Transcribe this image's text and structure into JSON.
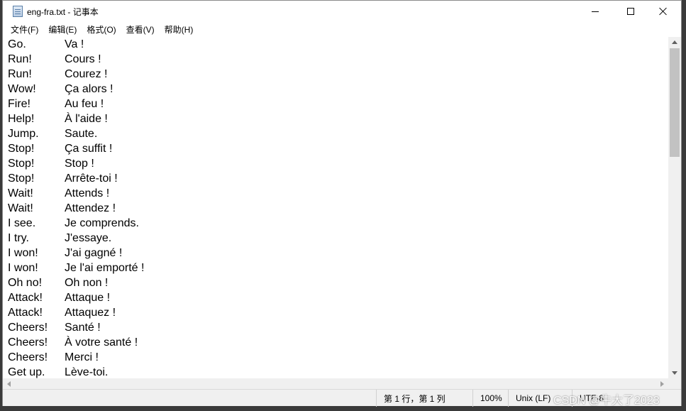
{
  "window": {
    "title": "eng-fra.txt - 记事本",
    "app_icon": "notepad-icon"
  },
  "menu": [
    {
      "label": "文件(F)"
    },
    {
      "label": "编辑(E)"
    },
    {
      "label": "格式(O)"
    },
    {
      "label": "查看(V)"
    },
    {
      "label": "帮助(H)"
    }
  ],
  "editor": {
    "lines": [
      {
        "en": "Go.",
        "fr": "Va !"
      },
      {
        "en": "Run!",
        "fr": "Cours !"
      },
      {
        "en": "Run!",
        "fr": "Courez !"
      },
      {
        "en": "Wow!",
        "fr": "Ça alors !"
      },
      {
        "en": "Fire!",
        "fr": "Au feu !"
      },
      {
        "en": "Help!",
        "fr": "À l'aide !"
      },
      {
        "en": "Jump.",
        "fr": "Saute."
      },
      {
        "en": "Stop!",
        "fr": "Ça suffit !"
      },
      {
        "en": "Stop!",
        "fr": "Stop !"
      },
      {
        "en": "Stop!",
        "fr": "Arrête-toi !"
      },
      {
        "en": "Wait!",
        "fr": "Attends !"
      },
      {
        "en": "Wait!",
        "fr": "Attendez !"
      },
      {
        "en": "I see.",
        "fr": "Je comprends."
      },
      {
        "en": "I try.",
        "fr": "J'essaye."
      },
      {
        "en": "I won!",
        "fr": "J'ai gagné !"
      },
      {
        "en": "I won!",
        "fr": "Je l'ai emporté !"
      },
      {
        "en": "Oh no!",
        "fr": "Oh non !"
      },
      {
        "en": "Attack!",
        "fr": "Attaque !"
      },
      {
        "en": "Attack!",
        "fr": "Attaquez !"
      },
      {
        "en": "Cheers!",
        "fr": "Santé !"
      },
      {
        "en": "Cheers!",
        "fr": "À votre santé !"
      },
      {
        "en": "Cheers!",
        "fr": "Merci !"
      },
      {
        "en": "Get up.",
        "fr": "Lève-toi."
      }
    ]
  },
  "status": {
    "position": "第 1 行，第 1 列",
    "zoom": "100%",
    "line_ending": "Unix (LF)",
    "encoding": "UTF-8"
  },
  "watermark": "CSDN @牛大了2023"
}
